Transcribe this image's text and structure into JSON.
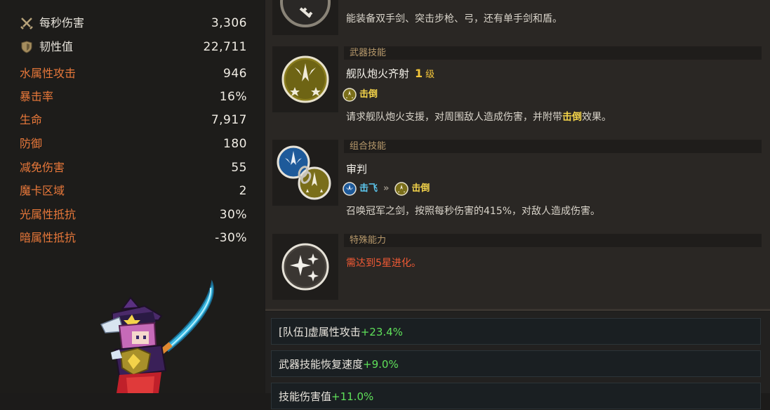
{
  "stats": [
    {
      "id": "dps",
      "icon": "crossed-swords-icon",
      "label": "每秒伤害",
      "value": "3,306",
      "style": "icon"
    },
    {
      "id": "toughness",
      "icon": "shield-icon",
      "label": "韧性值",
      "value": "22,711",
      "style": "icon"
    },
    {
      "id": "water_atk",
      "label": "水属性攻击",
      "value": "946",
      "style": "orange"
    },
    {
      "id": "crit",
      "label": "暴击率",
      "value": "16%",
      "style": "orange"
    },
    {
      "id": "hp",
      "label": "生命",
      "value": "7,917",
      "style": "orange"
    },
    {
      "id": "def",
      "label": "防御",
      "value": "180",
      "style": "orange"
    },
    {
      "id": "dmg_red",
      "label": "减免伤害",
      "value": "55",
      "style": "orange"
    },
    {
      "id": "card_area",
      "label": "魔卡区域",
      "value": "2",
      "style": "orange"
    },
    {
      "id": "light_res",
      "label": "光属性抵抗",
      "value": "30%",
      "style": "orange"
    },
    {
      "id": "dark_res",
      "label": "暗属性抵抗",
      "value": "-30%",
      "style": "orange"
    }
  ],
  "weapon_note": "能装备双手剑、突击步枪、弓，还有单手剑和盾。",
  "weapon_skill": {
    "section": "武器技能",
    "name": "舰队炮火齐射",
    "level_num": "1",
    "level_word": "级",
    "tag": "击倒",
    "desc_before": "请求舰队炮火支援，对周围敌人造成伤害，并附带",
    "desc_highlight": "击倒",
    "desc_after": "效果。"
  },
  "combo_skill": {
    "section": "组合技能",
    "name": "审判",
    "tag1": "击飞",
    "chevron": "»",
    "tag2": "击倒",
    "desc": "召唤冠军之剑，按照每秒伤害的415%，对敌人造成伤害。"
  },
  "special": {
    "section": "特殊能力",
    "text": "需达到5星进化。"
  },
  "options": [
    {
      "label": "[队伍]虚属性攻击",
      "bonus": "+23.4%"
    },
    {
      "label": "武器技能恢复速度",
      "bonus": "+9.0%"
    },
    {
      "label": "技能伤害值",
      "bonus": "+11.0%"
    }
  ],
  "colors": {
    "accent_orange": "#e8783a",
    "gold": "#f3d34a",
    "blue_tag": "#5cc8f0",
    "bonus_green": "#5fe05a",
    "warning_red": "#f25a35"
  }
}
